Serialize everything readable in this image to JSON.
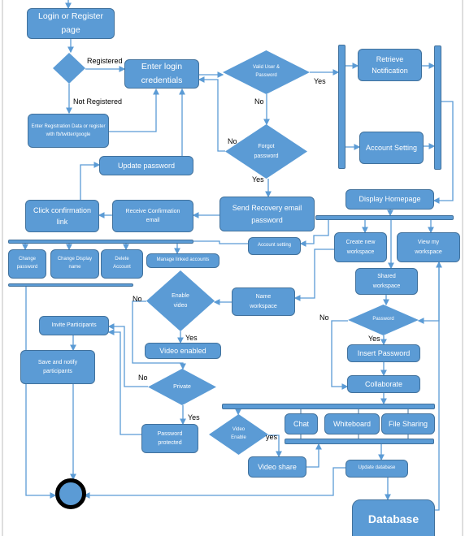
{
  "nodes": {
    "login_page": "Login or Register page",
    "enter_login": "Enter login credentials",
    "registration": "Enter Registration Data or register with fb/twitter/google",
    "valid_user": "Valid User & Password",
    "forgot_password": "Forgot password",
    "retrieve_notification": "Retrieve Notification",
    "account_setting": "Account Setting",
    "update_password": "Update password",
    "display_homepage": "Display Homepage",
    "send_recovery": "Send Recovery email password",
    "receive_confirmation": "Receive Confirmation email",
    "click_link": "Click confirmation link",
    "account_setting_small": "Account setting",
    "create_workspace": "Create new workspace",
    "view_workspace": "View my workspace",
    "change_password": "Change password",
    "change_display_name": "Change Display name",
    "delete_account": "Delete Account",
    "manage_linked": "Manage linked accounts",
    "enable_video": "Enable video",
    "name_workspace": "Name workspace",
    "shared_workspace": "Shared workspace",
    "password_decision": "Password",
    "invite_participants": "Invite Participants",
    "save_notify": "Save and notify participants",
    "video_enabled": "Video enabled",
    "insert_password": "Insert Password",
    "private": "Private",
    "collaborate": "Collaborate",
    "chat": "Chat",
    "whiteboard": "Whiteboard",
    "file_sharing": "File Sharing",
    "video_enable": "Video Enable",
    "password_protected": "Password protected",
    "video_share": "Video share",
    "update_database": "Update database",
    "database": "Database"
  },
  "edge_labels": {
    "registered": "Registered",
    "not_registered": "Not Registered",
    "valid_yes": "Yes",
    "valid_no": "No",
    "forgot_no": "No",
    "forgot_yes": "Yes",
    "video_no": "No",
    "video_yes": "Yes",
    "private_no": "No",
    "private_yes": "Yes",
    "password_no": "No",
    "password_yes": "Yes",
    "video_enable_yes": "yes"
  },
  "colors": {
    "fill": "#5B9BD5",
    "border": "#41719C",
    "line": "#5B9BD5",
    "end_ring": "#000000"
  }
}
